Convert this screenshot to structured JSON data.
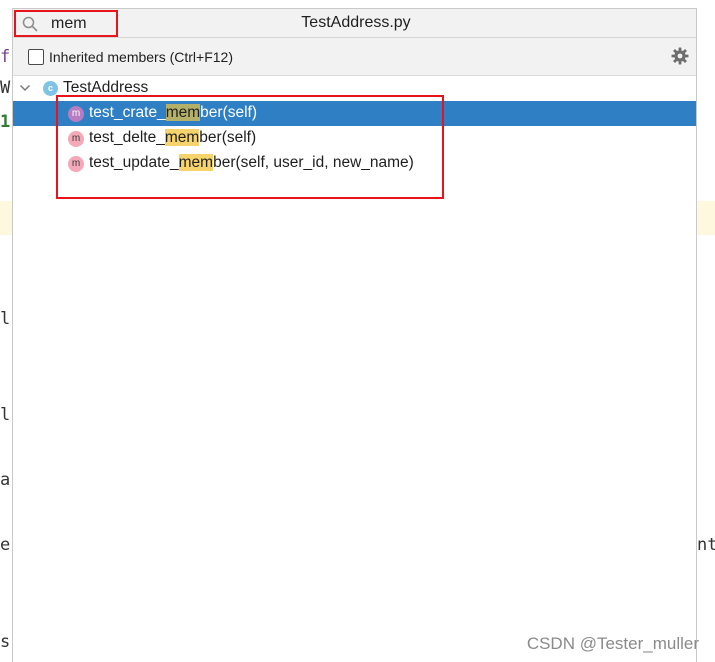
{
  "editor_fragments": {
    "f": "f",
    "w": "W",
    "one": "1",
    "l1": "l",
    "l2": "l",
    "a": "a",
    "e": "e",
    "s": "s",
    "nt": "nt"
  },
  "popup": {
    "search_value": "mem",
    "title": "TestAddress.py",
    "inherited_label": "Inherited members (Ctrl+F12)",
    "class_icon_letter": "c",
    "class_name": "TestAddress",
    "method_icon_letter": "m",
    "methods": [
      {
        "pre": "test_crate_",
        "match": "mem",
        "post": "ber(self)",
        "selected": true
      },
      {
        "pre": "test_delte_",
        "match": "mem",
        "post": "ber(self)",
        "selected": false
      },
      {
        "pre": "test_update_",
        "match": "mem",
        "post": "ber(self, user_id, new_name)",
        "selected": false
      }
    ]
  },
  "watermark": "CSDN @Tester_muller",
  "colors": {
    "selection": "#2f7fc5",
    "match_highlight": "#f7d46b",
    "annotation": "#e8141b"
  },
  "icons": [
    "search-icon",
    "gear-icon",
    "chevron-down-icon",
    "class-icon",
    "method-icon"
  ]
}
